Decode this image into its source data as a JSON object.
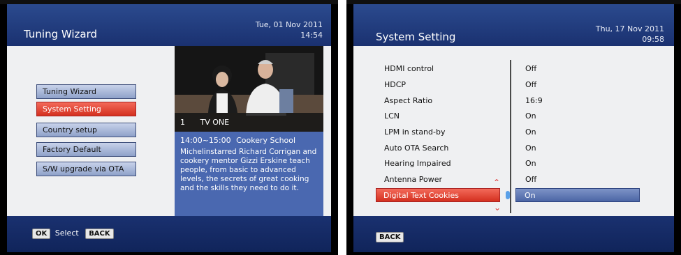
{
  "left_screen": {
    "title": "Tuning Wizard",
    "date": "Tue, 01 Nov 2011",
    "time": "14:54",
    "menu": [
      {
        "label": "Tuning Wizard",
        "active": false
      },
      {
        "label": "System Setting",
        "active": true
      },
      {
        "label": "Country setup",
        "active": false
      },
      {
        "label": "Factory Default",
        "active": false
      },
      {
        "label": "S/W upgrade via OTA",
        "active": false
      }
    ],
    "preview": {
      "channel_number": "1",
      "channel_name": "TV ONE",
      "time_range": "14:00~15:00",
      "program_title": "Cookery School",
      "description": "Michelinstarred Richard Corrigan and cookery mentor Gizzi Erskine teach people, from basic to advanced levels, the secrets of great cooking and the skills they need to do it."
    },
    "footer": {
      "ok_key": "OK",
      "select_label": "Select",
      "back_key": "BACK"
    }
  },
  "right_screen": {
    "title": "System Setting",
    "date": "Thu, 17 Nov 2011",
    "time": "09:58",
    "settings": [
      {
        "label": "HDMI control",
        "value": "Off"
      },
      {
        "label": "HDCP",
        "value": "Off"
      },
      {
        "label": "Aspect Ratio",
        "value": "16:9"
      },
      {
        "label": "LCN",
        "value": "On"
      },
      {
        "label": "LPM in stand-by",
        "value": "On"
      },
      {
        "label": "Auto OTA Search",
        "value": "On"
      },
      {
        "label": "Hearing Impaired",
        "value": "On"
      },
      {
        "label": "Antenna Power",
        "value": "Off"
      }
    ],
    "selected": {
      "label": "Digital Text Cookies",
      "value": "On"
    },
    "footer": {
      "back_key": "BACK"
    }
  },
  "colors": {
    "header_blue": "#1f3a7e",
    "highlight_red": "#e0402e",
    "value_blue": "#5a72b0",
    "panel_bg": "#eff0f2"
  }
}
